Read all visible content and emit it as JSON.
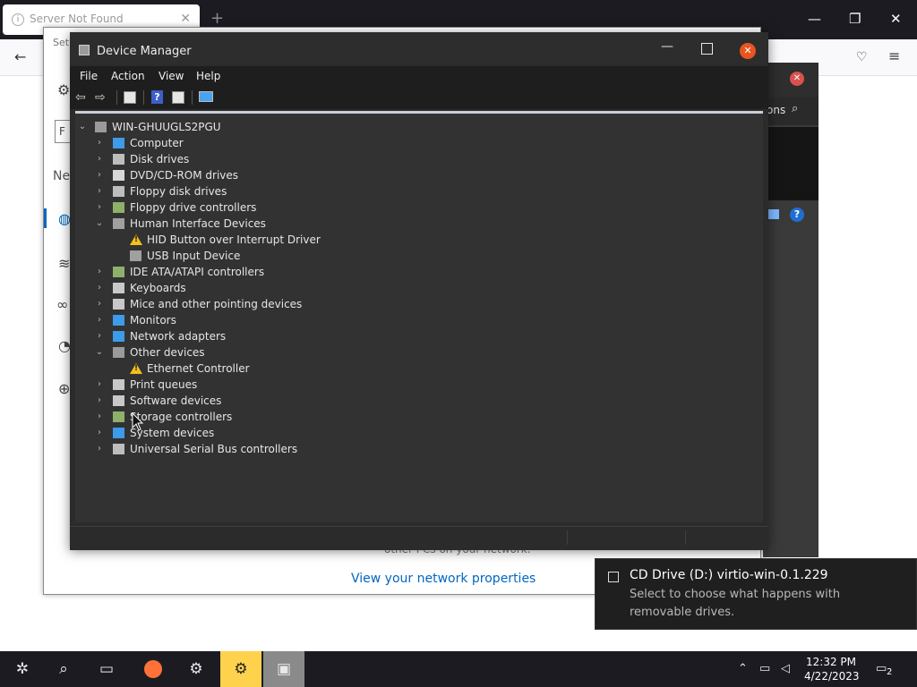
{
  "browser": {
    "tab_title": "Server Not Found",
    "tab_close": "✕",
    "new_tab": "+",
    "window_min": "—",
    "window_restore": "❐",
    "window_close": "✕"
  },
  "settings_window": {
    "title": "Set",
    "partial_label": "Ne",
    "search_letter": "F",
    "status_text": "other PCs on your network.",
    "link": "View your network properties"
  },
  "dark_dialog": {
    "search_text": "ons",
    "close": "✕",
    "help": "?"
  },
  "device_manager": {
    "title": "Device Manager",
    "menu": [
      "File",
      "Action",
      "View",
      "Help"
    ],
    "root": "WIN-GHUUGLS2PGU",
    "tree": [
      {
        "label": "Computer",
        "state": "collapsed",
        "icon": "computer-icon",
        "icon_color": "#3d9be8"
      },
      {
        "label": "Disk drives",
        "state": "collapsed",
        "icon": "disk-drive-icon",
        "icon_color": "#bdbdbd"
      },
      {
        "label": "DVD/CD-ROM drives",
        "state": "collapsed",
        "icon": "dvd-icon",
        "icon_color": "#d8d8d8"
      },
      {
        "label": "Floppy disk drives",
        "state": "collapsed",
        "icon": "floppy-icon",
        "icon_color": "#bdbdbd"
      },
      {
        "label": "Floppy drive controllers",
        "state": "collapsed",
        "icon": "controller-icon",
        "icon_color": "#8fb06a"
      },
      {
        "label": "Human Interface Devices",
        "state": "expanded",
        "icon": "hid-icon",
        "icon_color": "#a0a0a0"
      },
      {
        "label": "HID Button over Interrupt Driver",
        "state": "child",
        "icon": "warning-icon",
        "warning": true
      },
      {
        "label": "USB Input Device",
        "state": "child",
        "icon": "hid-icon",
        "icon_color": "#a0a0a0"
      },
      {
        "label": "IDE ATA/ATAPI controllers",
        "state": "collapsed",
        "icon": "controller-icon",
        "icon_color": "#8fb06a"
      },
      {
        "label": "Keyboards",
        "state": "collapsed",
        "icon": "keyboard-icon",
        "icon_color": "#c8c8c8"
      },
      {
        "label": "Mice and other pointing devices",
        "state": "collapsed",
        "icon": "mouse-icon",
        "icon_color": "#c8c8c8"
      },
      {
        "label": "Monitors",
        "state": "collapsed",
        "icon": "monitor-icon",
        "icon_color": "#3d9be8"
      },
      {
        "label": "Network adapters",
        "state": "collapsed",
        "icon": "network-icon",
        "icon_color": "#3d9be8"
      },
      {
        "label": "Other devices",
        "state": "expanded",
        "icon": "unknown-device-icon",
        "icon_color": "#9a9a9a"
      },
      {
        "label": "Ethernet Controller",
        "state": "child",
        "icon": "warning-icon",
        "warning": true
      },
      {
        "label": "Print queues",
        "state": "collapsed",
        "icon": "printer-icon",
        "icon_color": "#c8c8c8"
      },
      {
        "label": "Software devices",
        "state": "collapsed",
        "icon": "software-device-icon",
        "icon_color": "#c8c8c8"
      },
      {
        "label": "Storage controllers",
        "state": "collapsed",
        "icon": "storage-icon",
        "icon_color": "#8fb06a"
      },
      {
        "label": "System devices",
        "state": "collapsed",
        "icon": "system-icon",
        "icon_color": "#3d9be8"
      },
      {
        "label": "Universal Serial Bus controllers",
        "state": "collapsed",
        "icon": "usb-icon",
        "icon_color": "#bdbdbd"
      }
    ]
  },
  "toast": {
    "title": "CD Drive (D:) virtio-win-0.1.229",
    "body": "Select to choose what happens with removable drives."
  },
  "taskbar": {
    "time": "12:32 PM",
    "date": "4/22/2023",
    "notification_count": "2"
  }
}
